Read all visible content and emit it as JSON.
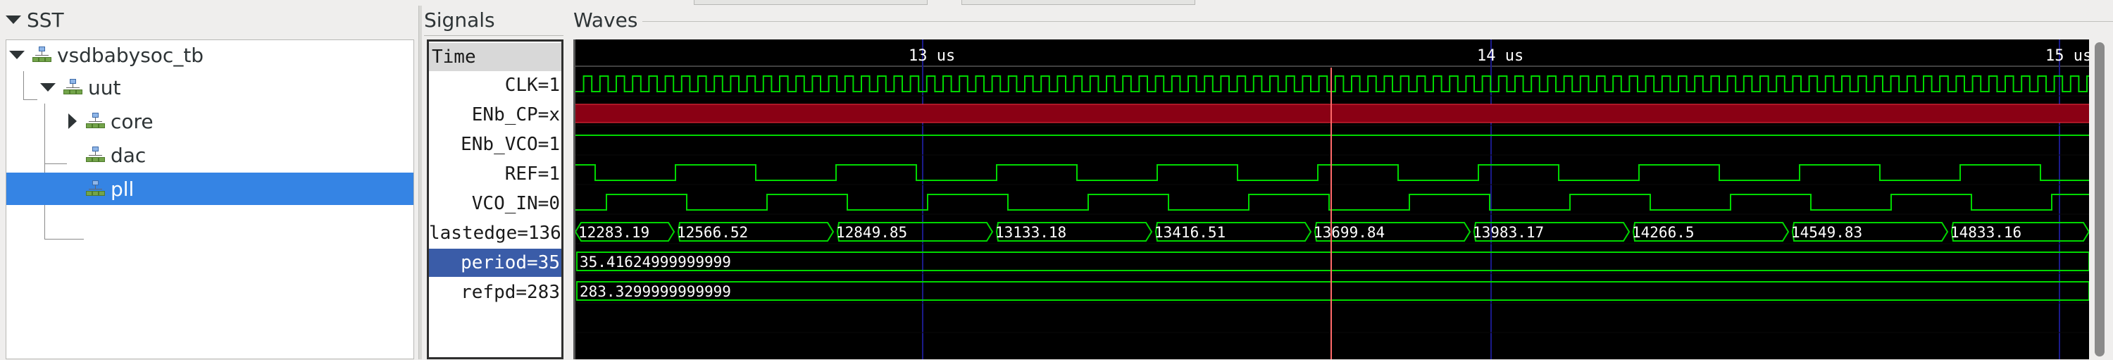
{
  "sst": {
    "title": "SST",
    "tree": [
      {
        "label": "vsdbabysoc_tb"
      },
      {
        "label": "uut"
      },
      {
        "label": "core"
      },
      {
        "label": "dac"
      },
      {
        "label": "pll"
      }
    ]
  },
  "signals": {
    "title": "Signals",
    "header": "Time",
    "rows": [
      {
        "name": "CLK",
        "text": "CLK=1"
      },
      {
        "name": "ENb_CP",
        "text": "ENb_CP=x"
      },
      {
        "name": "ENb_VCO",
        "text": "ENb_VCO=1"
      },
      {
        "name": "REF",
        "text": "REF=1"
      },
      {
        "name": "VCO_IN",
        "text": "VCO_IN=0"
      },
      {
        "name": "lastedge",
        "text": "lastedge=136"
      },
      {
        "name": "period",
        "text": "period=35"
      },
      {
        "name": "refpd",
        "text": "refpd=283"
      }
    ]
  },
  "waves": {
    "title": "Waves",
    "time_markers": [
      "13 us",
      "14 us",
      "15 us"
    ],
    "lastedge_values": [
      "12283.19",
      "12566.52",
      "12849.85",
      "13133.18",
      "13416.51",
      "13699.84",
      "13983.17",
      "14266.5",
      "14549.83",
      "14833.16"
    ],
    "period_value": "35.41624999999999",
    "refpd_value": "283.3299999999999"
  },
  "colors": {
    "wave": "#00d800",
    "undefined_fill": "#8a0014",
    "cursor": "#ff6a6a",
    "grid": "#1a1a8a",
    "selection": "#3584e4"
  }
}
